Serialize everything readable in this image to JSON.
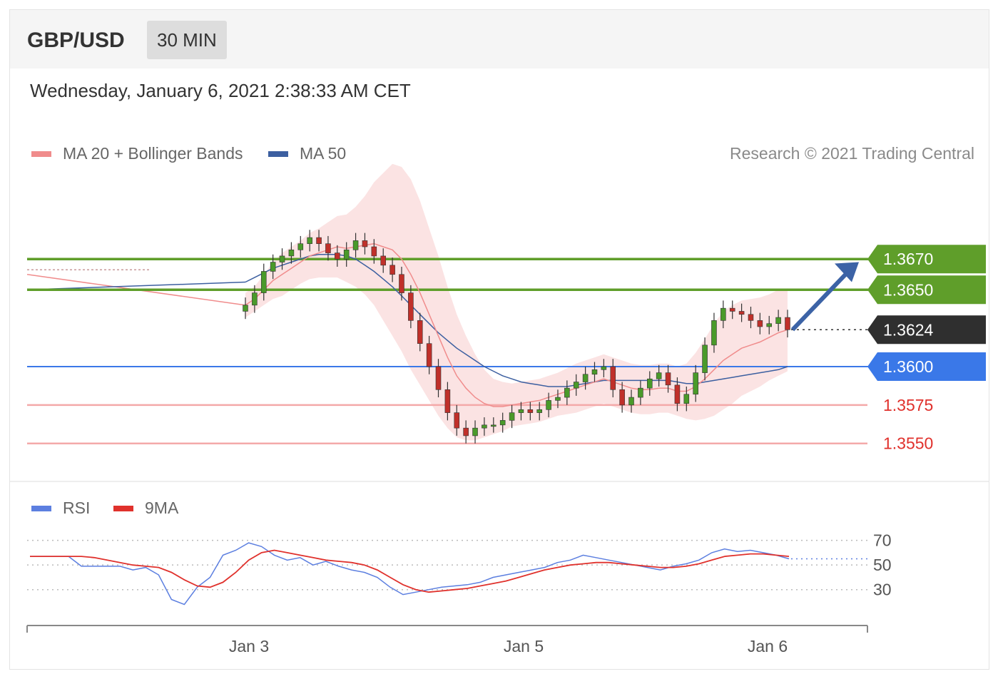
{
  "header": {
    "symbol": "GBP/USD",
    "timeframe": "30 MIN"
  },
  "datetime": "Wednesday, January 6, 2021 2:38:33 AM CET",
  "credit": "Research © 2021 Trading Central",
  "legend": [
    {
      "label": "MA 20 + Bollinger Bands",
      "color": "#f08c8c"
    },
    {
      "label": "MA 50",
      "color": "#3c5fa0"
    }
  ],
  "rsi_legend": [
    {
      "label": "RSI",
      "color": "#5c7fe0"
    },
    {
      "label": "9MA",
      "color": "#e0312c"
    }
  ],
  "chart_data": [
    {
      "type": "candlestick",
      "x_ticks": [
        "Jan 3",
        "Jan 5",
        "Jan 6"
      ],
      "ylim": [
        1.3535,
        1.373
      ],
      "levels": [
        {
          "value": 1.367,
          "label": "1.3670",
          "kind": "resistance",
          "color": "#5f9e2a"
        },
        {
          "value": 1.365,
          "label": "1.3650",
          "kind": "resistance",
          "color": "#5f9e2a"
        },
        {
          "value": 1.3624,
          "label": "1.3624",
          "kind": "last",
          "color": "#2f2f2f"
        },
        {
          "value": 1.36,
          "label": "1.3600",
          "kind": "pivot",
          "color": "#3a78e8"
        },
        {
          "value": 1.3575,
          "label": "1.3575",
          "kind": "support",
          "color": "#e0312c"
        },
        {
          "value": 1.355,
          "label": "1.3550",
          "kind": "support",
          "color": "#e0312c"
        }
      ],
      "trend_arrow": "up",
      "close": [
        1.364,
        1.3648,
        1.3662,
        1.3668,
        1.3672,
        1.3676,
        1.368,
        1.3684,
        1.368,
        1.3674,
        1.367,
        1.3676,
        1.3682,
        1.3678,
        1.3672,
        1.3666,
        1.366,
        1.3648,
        1.363,
        1.3615,
        1.36,
        1.3585,
        1.357,
        1.356,
        1.3555,
        1.356,
        1.3562,
        1.3562,
        1.3565,
        1.357,
        1.3572,
        1.357,
        1.3572,
        1.3578,
        1.358,
        1.3586,
        1.359,
        1.3595,
        1.3598,
        1.36,
        1.3585,
        1.3575,
        1.358,
        1.3586,
        1.3592,
        1.3596,
        1.3588,
        1.3576,
        1.3582,
        1.3596,
        1.3614,
        1.363,
        1.3638,
        1.3636,
        1.3634,
        1.363,
        1.3626,
        1.3628,
        1.3632,
        1.3624
      ],
      "ma20": [
        1.364,
        1.3644,
        1.365,
        1.3656,
        1.366,
        1.3664,
        1.3668,
        1.3672,
        1.3674,
        1.3676,
        1.3678,
        1.3677,
        1.3678,
        1.3679,
        1.368,
        1.3678,
        1.3676,
        1.367,
        1.366,
        1.3648,
        1.3634,
        1.362,
        1.3606,
        1.3594,
        1.3586,
        1.358,
        1.3576,
        1.3574,
        1.3574,
        1.3575,
        1.3576,
        1.3577,
        1.3578,
        1.358,
        1.3582,
        1.3584,
        1.3586,
        1.3588,
        1.359,
        1.3592,
        1.359,
        1.3588,
        1.3586,
        1.3585,
        1.3585,
        1.3586,
        1.3586,
        1.3584,
        1.3584,
        1.3587,
        1.3592,
        1.3598,
        1.3604,
        1.3608,
        1.3612,
        1.3614,
        1.3616,
        1.3619,
        1.3622,
        1.3624
      ],
      "ma50": [
        1.3655,
        1.3658,
        1.3661,
        1.3664,
        1.3666,
        1.3668,
        1.367,
        1.3672,
        1.3673,
        1.3673,
        1.3673,
        1.3672,
        1.367,
        1.3666,
        1.3662,
        1.3657,
        1.3652,
        1.3646,
        1.364,
        1.3634,
        1.3628,
        1.3622,
        1.3617,
        1.3612,
        1.3608,
        1.3604,
        1.36,
        1.3597,
        1.3594,
        1.3592,
        1.359,
        1.3589,
        1.3588,
        1.3587,
        1.3587,
        1.3587,
        1.3588,
        1.3589,
        1.359,
        1.3591,
        1.3591,
        1.3591,
        1.3591,
        1.3591,
        1.3591,
        1.3591,
        1.3591,
        1.359,
        1.3589,
        1.3589,
        1.359,
        1.3591,
        1.3592,
        1.3593,
        1.3594,
        1.3595,
        1.3596,
        1.3597,
        1.3598,
        1.36
      ],
      "bb_width": [
        0.0008,
        0.0008,
        0.001,
        0.0012,
        0.0014,
        0.0014,
        0.0014,
        0.0015,
        0.0016,
        0.0018,
        0.002,
        0.0022,
        0.0026,
        0.0032,
        0.004,
        0.0048,
        0.0056,
        0.006,
        0.0062,
        0.006,
        0.0056,
        0.0052,
        0.0046,
        0.004,
        0.0034,
        0.0028,
        0.0022,
        0.0018,
        0.0016,
        0.0014,
        0.0014,
        0.0014,
        0.0014,
        0.0014,
        0.0014,
        0.0015,
        0.0016,
        0.0016,
        0.0016,
        0.0016,
        0.0016,
        0.0016,
        0.0016,
        0.0016,
        0.0016,
        0.0016,
        0.0016,
        0.0016,
        0.0018,
        0.0022,
        0.0026,
        0.003,
        0.0032,
        0.0032,
        0.0031,
        0.003,
        0.0029,
        0.0028,
        0.0028,
        0.0027
      ]
    },
    {
      "type": "line",
      "title": "RSI",
      "y_ticks": [
        70,
        50,
        30
      ],
      "ylim": [
        10,
        80
      ],
      "series": [
        {
          "name": "RSI",
          "values": [
            57,
            57,
            57,
            57,
            49,
            49,
            49,
            49,
            46,
            48,
            42,
            22,
            18,
            32,
            40,
            58,
            62,
            68,
            65,
            58,
            54,
            56,
            50,
            53,
            49,
            46,
            44,
            40,
            32,
            26,
            28,
            30,
            32,
            33,
            34,
            36,
            40,
            42,
            44,
            46,
            48,
            52,
            54,
            58,
            56,
            54,
            52,
            50,
            48,
            46,
            49,
            51,
            54,
            60,
            63,
            61,
            62,
            60,
            58,
            55
          ]
        },
        {
          "name": "9MA",
          "values": [
            57,
            57,
            57,
            57,
            57,
            56,
            54,
            52,
            50,
            49,
            48,
            44,
            38,
            33,
            32,
            36,
            44,
            54,
            60,
            62,
            60,
            58,
            56,
            54,
            53,
            52,
            50,
            46,
            40,
            34,
            30,
            28,
            29,
            30,
            31,
            33,
            35,
            37,
            40,
            43,
            46,
            48,
            50,
            51,
            52,
            52,
            51,
            50,
            49,
            48,
            48,
            49,
            51,
            54,
            57,
            58,
            59,
            59,
            58,
            57
          ]
        }
      ]
    }
  ]
}
